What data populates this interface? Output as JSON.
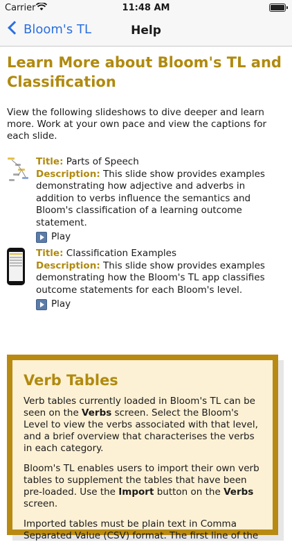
{
  "status_bar": {
    "carrier": "Carrier",
    "time": "11:48 AM"
  },
  "nav": {
    "back_label": "Bloom's TL",
    "title": "Help"
  },
  "page": {
    "title": "Learn More about Bloom's TL and Classification",
    "intro": "View the following slideshows to dive deeper and learn more. Work at your own pace and view the captions for each slide."
  },
  "slides": [
    {
      "title_key": "Title:",
      "title_value": "Parts of Speech",
      "description_key": "Description:",
      "description_value": "This slide show provides examples demonstrating how adjective and adverbs in addition to verbs influence the semantics and Bloom's classification of a learning outcome statement.",
      "play_label": "Play",
      "thumbnail": "tree-diagram-thumbnail"
    },
    {
      "title_key": "Title:",
      "title_value": "Classification Examples",
      "description_key": "Description:",
      "description_value": "This slide show provides examples demonstrating how the Bloom's TL app classifies outcome statements for each Bloom's level.",
      "play_label": "Play",
      "thumbnail": "phone-thumbnail"
    }
  ],
  "verb_tables": {
    "title": "Verb Tables",
    "p1_a": "Verb tables currently loaded in Bloom's TL can be seen on the ",
    "p1_verbs": "Verbs",
    "p1_b": " screen. Select the Bloom's Level to view the verbs associated with that level, and a brief overview that characterises the verbs in each category.",
    "p2_a": "Bloom's TL enables users to import their own verb tables to supplement the tables that have been pre-loaded. Use the ",
    "p2_import": "Import",
    "p2_b": " button on the ",
    "p2_verbs": "Verbs",
    "p2_c": " screen.",
    "p3": "Imported tables must be plain text in Comma Separated Value (CSV) format. The first line of the"
  },
  "colors": {
    "accent": "#b08a0f",
    "link": "#2a6fe0",
    "card_border": "#b88a12",
    "card_bg": "#fdf1d5"
  },
  "icons": [
    "wifi-icon",
    "battery-icon",
    "chevron-left-icon",
    "play-icon"
  ]
}
